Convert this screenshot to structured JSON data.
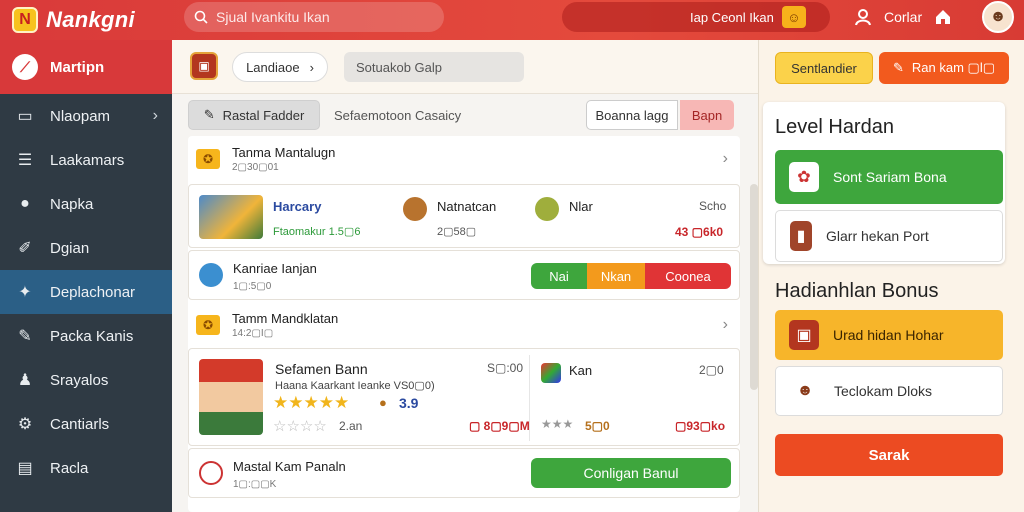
{
  "app": {
    "title": "Nankgni",
    "logo_glyph": "N"
  },
  "search": {
    "placeholder": "Sjual Ivankitu Ikan"
  },
  "topbar": {
    "tag_label": "Iap Ceonl Ikan",
    "user_label": "Corlar",
    "avatar_icon": "user-avatar"
  },
  "sidebar": {
    "header": "Martipn",
    "items": [
      {
        "label": "Nlaopam",
        "icon": "folder-icon",
        "has_chevron": true
      },
      {
        "label": "Laakamars",
        "icon": "list-icon"
      },
      {
        "label": "Napka",
        "icon": "chat-icon"
      },
      {
        "label": "Dgian",
        "icon": "pin-icon"
      },
      {
        "label": "Deplachonar",
        "icon": "tag-icon",
        "active": true
      },
      {
        "label": "Packa Kanis",
        "icon": "gift-icon"
      },
      {
        "label": "Srayalos",
        "icon": "user-icon"
      },
      {
        "label": "Cantiarls",
        "icon": "gear-icon"
      },
      {
        "label": "Racla",
        "icon": "doc-icon"
      }
    ]
  },
  "crumbs": {
    "first": "Landiaoe",
    "second": "Sotuakob Galp"
  },
  "filter": {
    "button": "Rastal Fadder",
    "text": "Sefaemotoon Casaicy",
    "input_value": "Boanna lagg",
    "go": "Bapn"
  },
  "groups": [
    {
      "title": "Tanma Mantalugn",
      "sub": "2▢30▢01"
    },
    {
      "title": "Tamm Mandklatan",
      "sub": "14:2▢I▢"
    }
  ],
  "row1": {
    "c1_title": "Harcary",
    "c1_sub": "Ftaomakur 1.5▢6",
    "c2_title": "Natnatcan",
    "c2_sub": "2▢58▢",
    "c3_title": "Nlar",
    "c3_right": "Scho",
    "c3_value": "43 ▢6k0"
  },
  "row2": {
    "title": "Kanriae Ianjan",
    "sub": "1▢:5▢0",
    "seg": [
      "Nai",
      "Nkan",
      "Coonea"
    ]
  },
  "row3": {
    "name": "Sefamen Bann",
    "price": "S▢:00",
    "desc": "Haana Kaarkant Ieanke VS0▢0)",
    "rating": "3.9",
    "sub_rating": "2.an",
    "value": "▢ 8▢9▢M",
    "c2_name": "Kan",
    "c2_price": "2▢0",
    "c2_rating": "5▢0",
    "c2_value": "▢93▢ko"
  },
  "row4": {
    "title": "Mastal Kam Panaln",
    "sub": "1▢:▢▢K",
    "button": "Conligan Banul"
  },
  "right": {
    "btn1": "Sentlandier",
    "btn2": "Ran kam ▢l▢",
    "panel1_title": "Level Hardan",
    "p1_green": "Sont Sariam Bona",
    "p1_white": "Glarr hekan    Port",
    "panel2_title": "Hadianhlan Bonus",
    "p2_yellow": "Urad hidan  Hohar",
    "p2_white": "Teclokam  Dloks",
    "bottom": "Sarak"
  },
  "colors": {
    "brand_red": "#d93a3a",
    "active_blue": "#2b5f86",
    "green": "#3ea63d",
    "orange": "#f39a1c",
    "yellow": "#f7b52a"
  }
}
